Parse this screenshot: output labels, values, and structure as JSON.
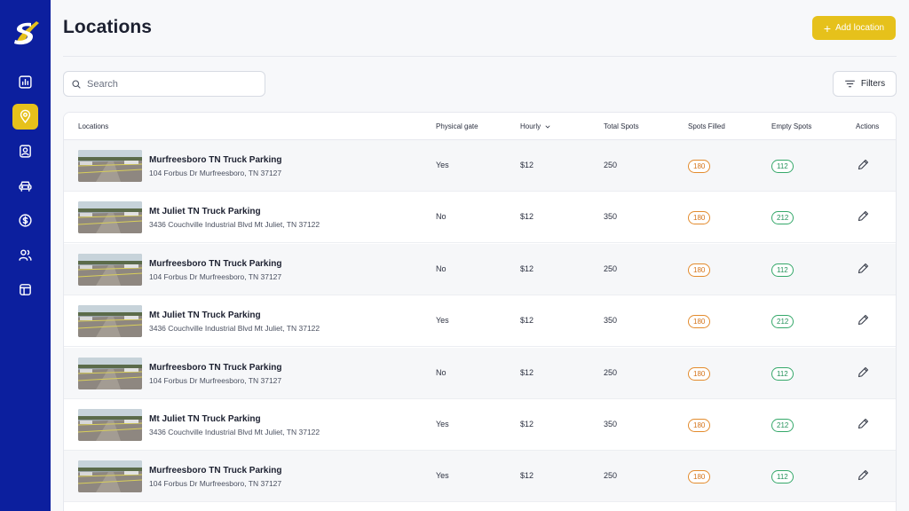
{
  "page": {
    "title": "Locations",
    "add_label": "Add location"
  },
  "search": {
    "placeholder": "Search"
  },
  "filters_label": "Filters",
  "sidebar": {
    "items": [
      {
        "name": "dashboard",
        "icon": "chart-icon",
        "active": false
      },
      {
        "name": "locations",
        "icon": "map-pin-icon",
        "active": true
      },
      {
        "name": "contacts",
        "icon": "id-card-icon",
        "active": false
      },
      {
        "name": "vehicles",
        "icon": "car-icon",
        "active": false
      },
      {
        "name": "payments",
        "icon": "dollar-icon",
        "active": false
      },
      {
        "name": "users",
        "icon": "users-icon",
        "active": false
      },
      {
        "name": "layout",
        "icon": "layout-icon",
        "active": false
      }
    ]
  },
  "table": {
    "headers": {
      "locations": "Locations",
      "gate": "Physical gate",
      "hourly": "Hourly",
      "total": "Total Spots",
      "filled": "Spots Filled",
      "empty": "Empty Spots",
      "actions": "Actions"
    },
    "rows": [
      {
        "name": "Murfreesboro TN Truck Parking",
        "address": "104 Forbus Dr Murfreesboro, TN 37127",
        "gate": "Yes",
        "hourly": "$12",
        "total": "250",
        "filled": "180",
        "empty": "112"
      },
      {
        "name": "Mt Juliet TN Truck Parking",
        "address": "3436 Couchville Industrial Blvd Mt Juliet, TN 37122",
        "gate": "No",
        "hourly": "$12",
        "total": "350",
        "filled": "180",
        "empty": "212"
      },
      {
        "name": "Murfreesboro TN Truck Parking",
        "address": "104 Forbus Dr Murfreesboro, TN 37127",
        "gate": "No",
        "hourly": "$12",
        "total": "250",
        "filled": "180",
        "empty": "112"
      },
      {
        "name": "Mt Juliet TN Truck Parking",
        "address": "3436 Couchville Industrial Blvd Mt Juliet, TN 37122",
        "gate": "Yes",
        "hourly": "$12",
        "total": "350",
        "filled": "180",
        "empty": "212"
      },
      {
        "name": "Murfreesboro TN Truck Parking",
        "address": "104 Forbus Dr Murfreesboro, TN 37127",
        "gate": "No",
        "hourly": "$12",
        "total": "250",
        "filled": "180",
        "empty": "112"
      },
      {
        "name": "Mt Juliet TN Truck Parking",
        "address": "3436 Couchville Industrial Blvd Mt Juliet, TN 37122",
        "gate": "Yes",
        "hourly": "$12",
        "total": "350",
        "filled": "180",
        "empty": "212"
      },
      {
        "name": "Murfreesboro TN Truck Parking",
        "address": "104 Forbus Dr Murfreesboro, TN 37127",
        "gate": "Yes",
        "hourly": "$12",
        "total": "250",
        "filled": "180",
        "empty": "112"
      }
    ]
  },
  "colors": {
    "sidebar": "#0c1f9e",
    "accent": "#e6c11b",
    "filled_badge": "#e38b2d",
    "empty_badge": "#35a86a"
  }
}
